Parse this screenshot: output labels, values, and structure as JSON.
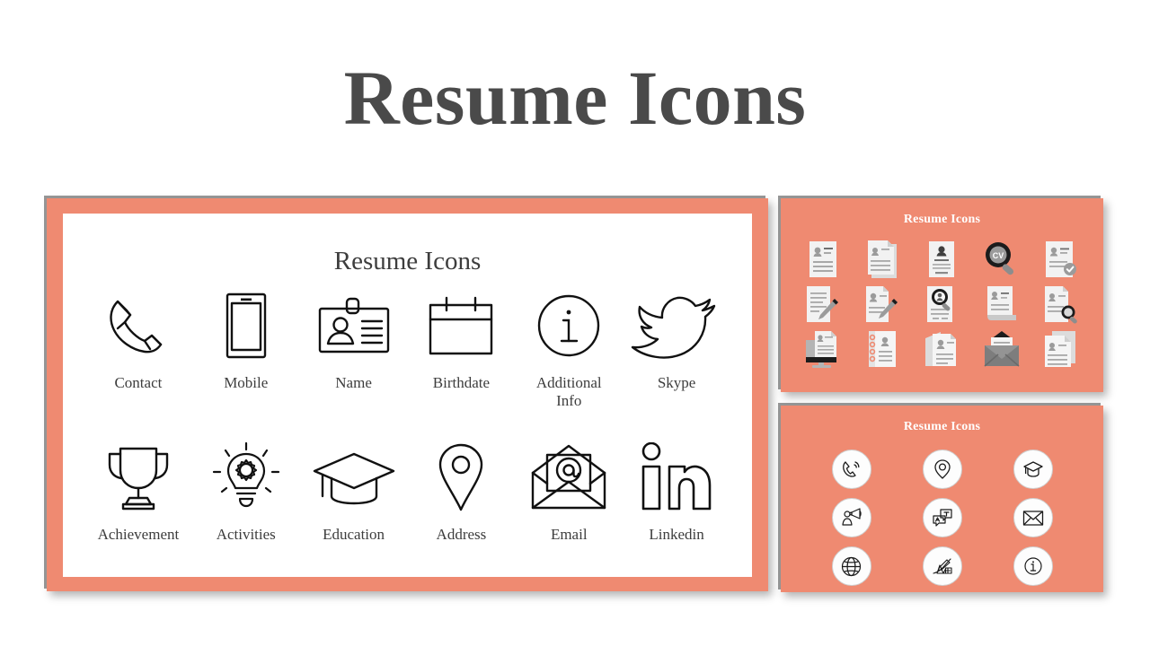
{
  "page": {
    "title": "Resume Icons",
    "background_color": "#ffffff",
    "title_color": "#4a4a4a"
  },
  "theme": {
    "accent_color": "#ef8a71",
    "panel_border_color": "#ef8a71",
    "shadow_color": "#828282",
    "line_icon_color": "#1a1a1a",
    "flat_icon_paper": "#f0f0f0",
    "flat_icon_ink": "#9a9a9a",
    "flat_icon_dark": "#3f3f3f"
  },
  "main_slide": {
    "heading": "Resume Icons",
    "canvas_color": "#ffffff",
    "rows": [
      {
        "name": "row-1",
        "items": [
          {
            "label": "Contact",
            "icon": "phone-handset-icon"
          },
          {
            "label": "Mobile",
            "icon": "mobile-phone-icon"
          },
          {
            "label": "Name",
            "icon": "id-badge-icon"
          },
          {
            "label": "Birthdate",
            "icon": "calendar-icon"
          },
          {
            "label": "Additional Info",
            "icon": "info-circle-icon"
          },
          {
            "label": "Skype",
            "icon": "bird-icon"
          }
        ]
      },
      {
        "name": "row-2",
        "items": [
          {
            "label": "Achievement",
            "icon": "trophy-icon"
          },
          {
            "label": "Activities",
            "icon": "lightbulb-gear-icon"
          },
          {
            "label": "Education",
            "icon": "graduation-cap-icon"
          },
          {
            "label": "Address",
            "icon": "map-pin-icon"
          },
          {
            "label": "Email",
            "icon": "open-envelope-at-icon"
          },
          {
            "label": "Linkedin",
            "icon": "linkedin-icon"
          }
        ]
      }
    ]
  },
  "thumbnail_flat": {
    "title": "Resume Icons",
    "background_color": "#ef8a71",
    "icons": [
      {
        "name": "resume-document-icon",
        "badge": ""
      },
      {
        "name": "resume-stack-icon",
        "badge": ""
      },
      {
        "name": "resume-centered-photo-icon",
        "badge": ""
      },
      {
        "name": "cv-magnifier-icon",
        "badge": "CV"
      },
      {
        "name": "resume-verified-check-icon",
        "badge": ""
      },
      {
        "name": "document-pen-edit-icon",
        "badge": ""
      },
      {
        "name": "resume-pen-edit-icon",
        "badge": ""
      },
      {
        "name": "resume-search-avatar-icon",
        "badge": ""
      },
      {
        "name": "resume-scroll-icon",
        "badge": ""
      },
      {
        "name": "resume-magnifier-corner-icon",
        "badge": ""
      },
      {
        "name": "resume-on-monitor-icon",
        "badge": ""
      },
      {
        "name": "spiral-bound-resume-icon",
        "badge": ""
      },
      {
        "name": "stacked-resumes-icon",
        "badge": ""
      },
      {
        "name": "resume-in-envelope-icon",
        "badge": ""
      },
      {
        "name": "duplicate-resume-icon",
        "badge": ""
      }
    ]
  },
  "thumbnail_line": {
    "title": "Resume Icons",
    "background_color": "#ef8a71",
    "circle_fill": "#fdfdfd",
    "icons": [
      {
        "name": "phone-signal-icon"
      },
      {
        "name": "map-pin-icon"
      },
      {
        "name": "graduation-cap-icon"
      },
      {
        "name": "megaphone-person-icon"
      },
      {
        "name": "chat-translate-icon"
      },
      {
        "name": "envelope-icon"
      },
      {
        "name": "globe-web-icon"
      },
      {
        "name": "design-sketch-icon"
      },
      {
        "name": "info-circle-icon"
      }
    ]
  }
}
